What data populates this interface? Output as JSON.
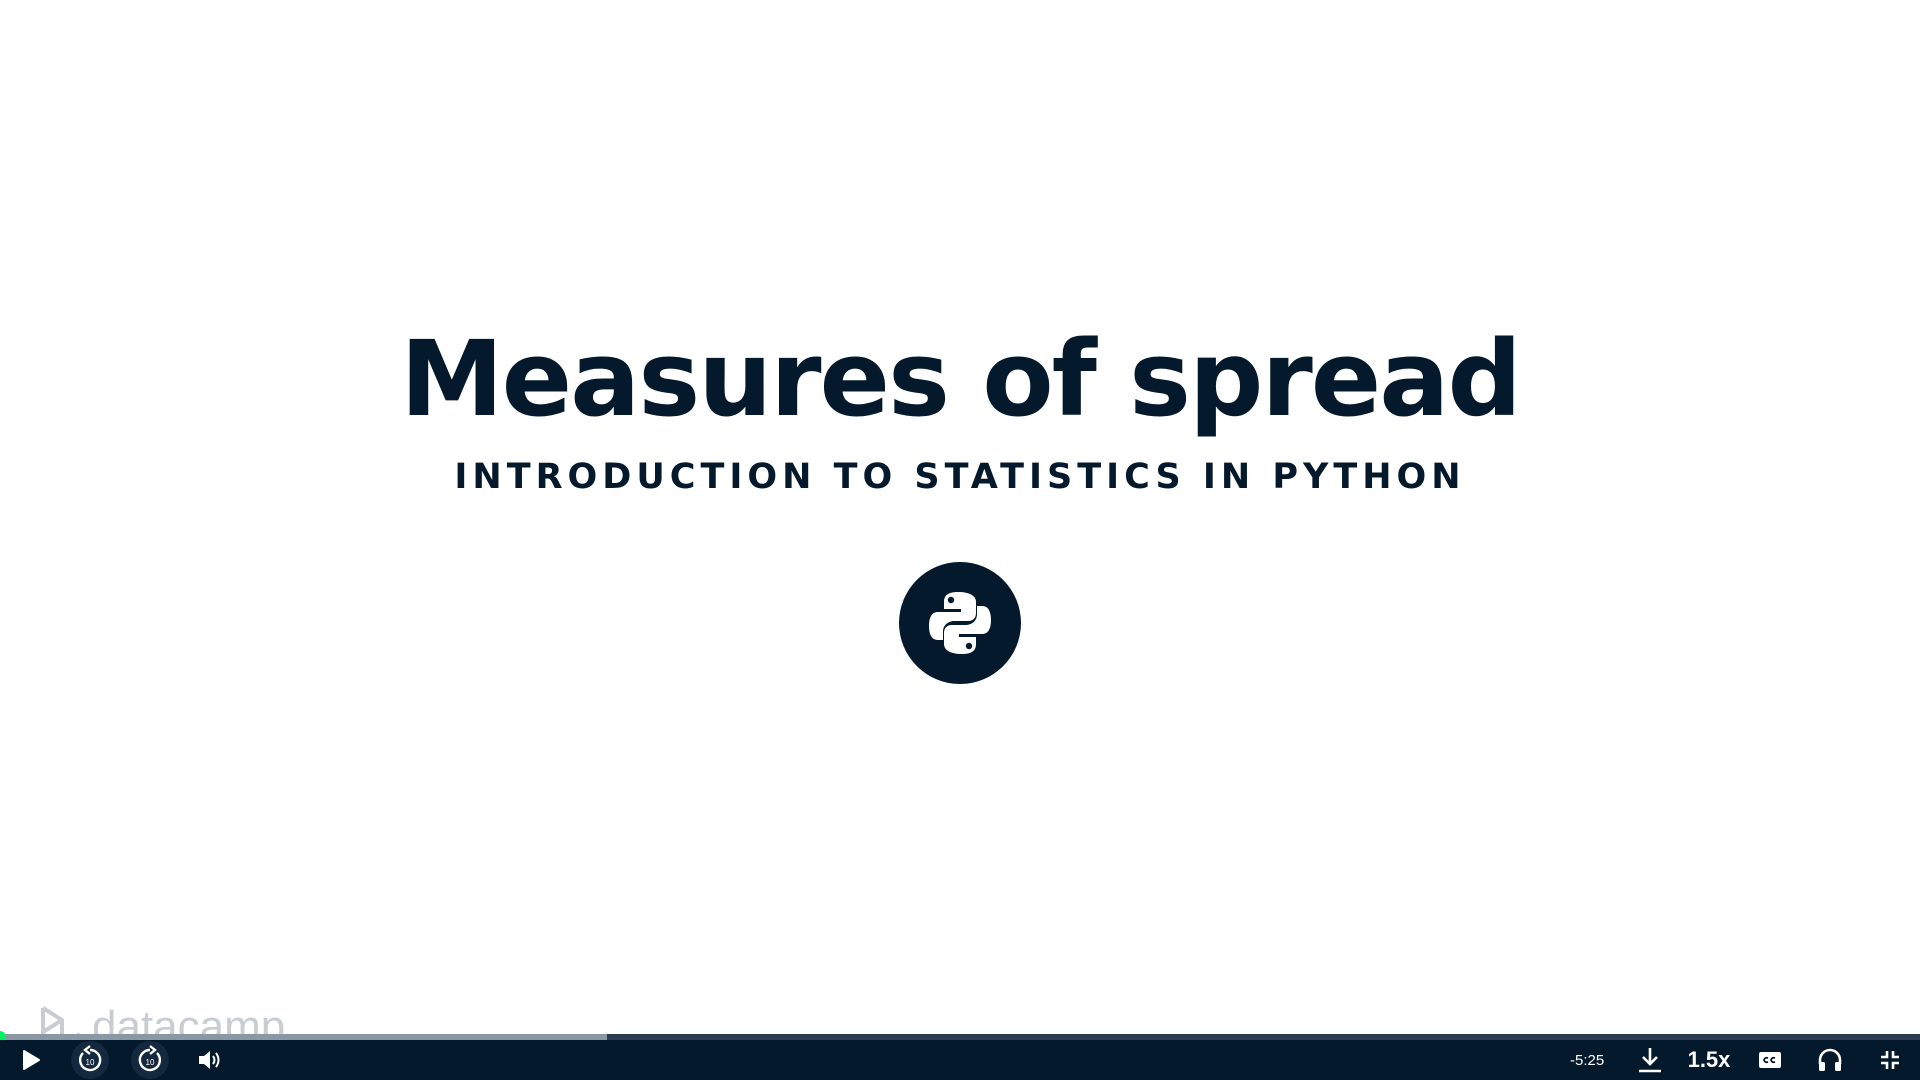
{
  "slide": {
    "title": "Measures of spread",
    "subtitle": "INTRODUCTION TO STATISTICS IN PYTHON",
    "logo_icon": "python-logo-icon",
    "watermark": "datacamp"
  },
  "player": {
    "progress_fraction": 0.0,
    "buffered_fraction": 0.316,
    "time_remaining": "-5:25",
    "speed_label": "1.5x",
    "icons": {
      "play": "play-icon",
      "rewind": "rewind-10-icon",
      "forward": "forward-10-icon",
      "volume": "volume-icon",
      "download": "download-icon",
      "captions": "cc-icon",
      "audio": "headphones-icon",
      "fullscreen": "exit-fullscreen-icon"
    },
    "skip_seconds": "10"
  },
  "colors": {
    "navy": "#05192d",
    "accent_green": "#03ef62",
    "buffer": "#8a98a6",
    "watermark": "#c9cdd2"
  }
}
